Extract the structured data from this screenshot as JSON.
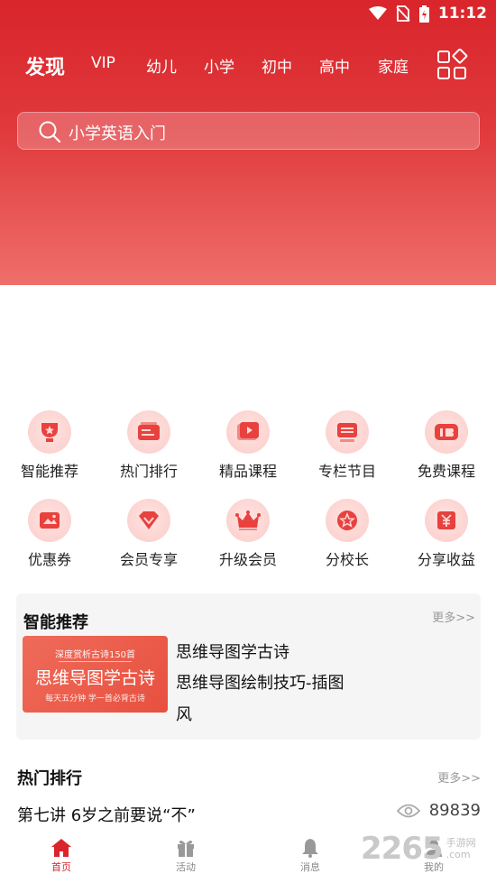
{
  "status": {
    "time": "11:12"
  },
  "nav": {
    "active": "发现",
    "tabs": [
      "VIP",
      "幼儿",
      "小学",
      "初中",
      "高中",
      "家庭"
    ]
  },
  "search": {
    "placeholder": "小学英语入门"
  },
  "shortcuts": [
    {
      "label": "智能推荐",
      "icon": "trophy-icon"
    },
    {
      "label": "热门排行",
      "icon": "cards-icon"
    },
    {
      "label": "精品课程",
      "icon": "video-icon"
    },
    {
      "label": "专栏节目",
      "icon": "column-icon"
    },
    {
      "label": "免费课程",
      "icon": "free-icon"
    },
    {
      "label": "优惠券",
      "icon": "coupon-icon"
    },
    {
      "label": "会员专享",
      "icon": "diamond-icon"
    },
    {
      "label": "升级会员",
      "icon": "crown-icon"
    },
    {
      "label": "分校长",
      "icon": "star-badge-icon"
    },
    {
      "label": "分享收益",
      "icon": "money-icon"
    }
  ],
  "recommend": {
    "title": "智能推荐",
    "more": "更多>>",
    "thumb": {
      "line1": "深度赏析古诗150首",
      "line2": "思维导图学古诗",
      "line3": "每天五分钟  学一首必背古诗"
    },
    "items": [
      "思维导图学古诗",
      "思维导图绘制技巧-插图",
      "风"
    ]
  },
  "hot": {
    "title": "热门排行",
    "more": "更多>>",
    "item": {
      "title": "第七讲 6岁之前要说“不”",
      "views": "89839"
    }
  },
  "tabbar": [
    "首页",
    "活动",
    "消息",
    "我的"
  ],
  "watermark": {
    "number": "2265",
    "line1": "手游网",
    "line2": ".com"
  },
  "colors": {
    "brand": "#d9252b"
  }
}
